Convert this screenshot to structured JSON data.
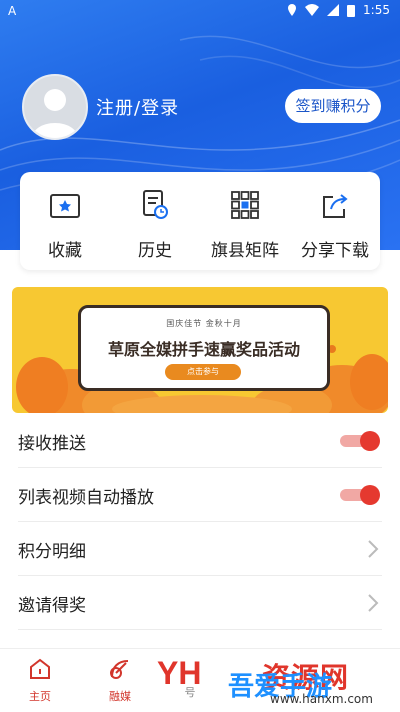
{
  "status_bar": {
    "time": "1:55",
    "notif_glyph": "A"
  },
  "profile": {
    "login_label": "注册/登录",
    "signin_button": "签到赚积分"
  },
  "quick_actions": [
    {
      "label": "收藏",
      "icon": "favorites-folder-icon"
    },
    {
      "label": "历史",
      "icon": "history-document-icon"
    },
    {
      "label": "旗县矩阵",
      "icon": "matrix-grid-icon"
    },
    {
      "label": "分享下载",
      "icon": "share-download-icon"
    }
  ],
  "banner": {
    "subtitle": "国庆佳节   金秋十月",
    "title": "草原全媒拼手速赢奖品活动",
    "cta": "点击参与"
  },
  "settings": [
    {
      "label": "接收推送",
      "control": "toggle",
      "on": true
    },
    {
      "label": "列表视频自动播放",
      "control": "toggle",
      "on": true
    },
    {
      "label": "积分明细",
      "control": "chevron"
    },
    {
      "label": "邀请得奖",
      "control": "chevron"
    }
  ],
  "tabbar": [
    {
      "label": "主页",
      "icon": "home-icon"
    },
    {
      "label": "融媒",
      "icon": "satellite-dish-icon"
    },
    {
      "label": "号",
      "icon": "account-icon"
    },
    {
      "label": "",
      "icon": "profile-icon"
    }
  ],
  "watermark": {
    "text1": "资源网",
    "text2": "吾爱手游",
    "url": "www.hanxm.com"
  },
  "colors": {
    "primary_blue": "#1a5fe0",
    "accent_red": "#e5392f",
    "banner_yellow": "#f7c832"
  }
}
